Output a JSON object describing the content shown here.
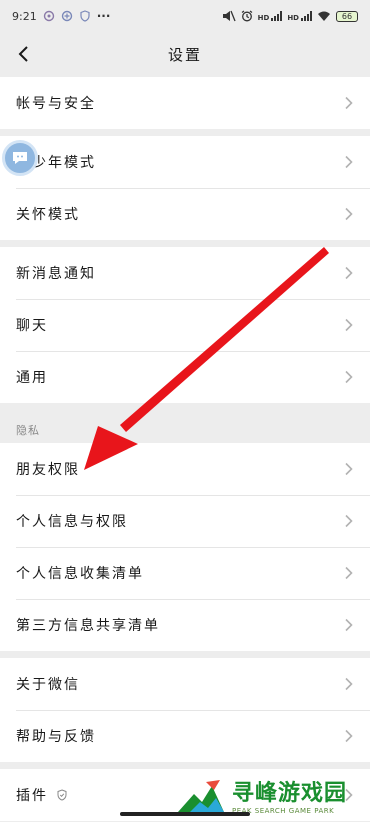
{
  "status_bar": {
    "time": "9:21",
    "battery": "66",
    "hd1": "HD",
    "hd2": "HD",
    "dots": "···"
  },
  "header": {
    "title": "设置"
  },
  "groups": [
    {
      "items": [
        {
          "label": "帐号与安全"
        }
      ]
    },
    {
      "items": [
        {
          "label": "青少年模式"
        },
        {
          "label": "关怀模式"
        }
      ]
    },
    {
      "items": [
        {
          "label": "新消息通知"
        },
        {
          "label": "聊天"
        },
        {
          "label": "通用"
        }
      ]
    },
    {
      "header": "隐私",
      "items": [
        {
          "label": "朋友权限"
        },
        {
          "label": "个人信息与权限"
        },
        {
          "label": "个人信息收集清单"
        },
        {
          "label": "第三方信息共享清单"
        }
      ]
    },
    {
      "items": [
        {
          "label": "关于微信"
        },
        {
          "label": "帮助与反馈"
        }
      ]
    },
    {
      "items": [
        {
          "label": "插件"
        }
      ]
    }
  ],
  "watermark": {
    "main": "寻峰游戏园",
    "sub": "PEAK SEARCH GAME PARK"
  },
  "colors": {
    "arrow": "#e8151b",
    "background": "#ededed",
    "watermark": "#1a8f2f"
  }
}
